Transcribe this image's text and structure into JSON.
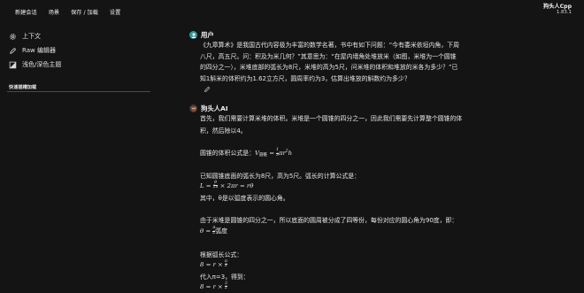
{
  "nav": {
    "items": [
      "新建会话",
      "场景",
      "保存 / 加载",
      "设置"
    ]
  },
  "brand": {
    "name": "狗头人Cpp",
    "version": "1.83.1"
  },
  "sidebar": {
    "items": [
      {
        "label": "上下文",
        "icon": "gear-icon"
      },
      {
        "label": "Raw 编辑器",
        "icon": "pencil-icon"
      },
      {
        "label": "浅色/深色主题",
        "icon": "theme-icon"
      }
    ],
    "section_label": "快速插槽加载"
  },
  "user_message": {
    "sender": "用户",
    "line1": "《九章算术》是我国古代内容极为丰富的数学名著，书中有如下问题：“今有委米依垣内角，下周",
    "line2": "八尺，高五尺。问：积及为米几何？”其意思为：“在屋内墙角处堆放米（如图，米堆为一个圆锥",
    "line3": "的四分之一），米堆底部的弧长为8尺，米堆的高为5尺，问米堆的体积和堆放的米各为多少？”已",
    "line4": "知1斛米的体积约为1.62立方尺，圆周率约为3，估算出堆放的斛数约为多少？"
  },
  "ai_message": {
    "sender": "狗头人AI",
    "p1a": "首先，我们需要计算米堆的体积。米堆是一个圆锥的四分之一，因此我们需要先计算整个圆锥的体",
    "p1b": "积，然后除以4。",
    "p2_label": "圆锥的体积公式是：",
    "p2_formula_v": "V",
    "p2_formula_sub": "圆锥",
    "p2_formula_rest": " = ",
    "p2_frac_num": "1",
    "p2_frac_den": "3",
    "p2_formula_tail": "πr",
    "p2_formula_tail2": "h",
    "p3": "已知圆锥底面的弧长为8尺，高为5尺。弧长的计算公式是：",
    "p3_formula_l": "L = ",
    "p3_frac_num": "θ",
    "p3_frac_den": "2π",
    "p3_formula_rest": " × 2πr = rθ",
    "p4": "其中，θ是以弧度表示的圆心角。",
    "p5": "由于米堆是圆锥的四分之一，所以底面的圆周被分成了四等份，每份对应的圆心角为90度，即：",
    "p5_formula_l": "θ = ",
    "p5_frac_num": "π",
    "p5_frac_den": "2",
    "p5_unit": "弧度",
    "p6": "根据弧长公式：",
    "p6_formula_l": "8 = r × ",
    "p6_frac_num": "π",
    "p6_frac_den": "2",
    "p7": "代入π=3，得到：",
    "p7_formula_l": "8 = r × ",
    "p7_frac_num": "3",
    "p7_frac_den": "2"
  }
}
